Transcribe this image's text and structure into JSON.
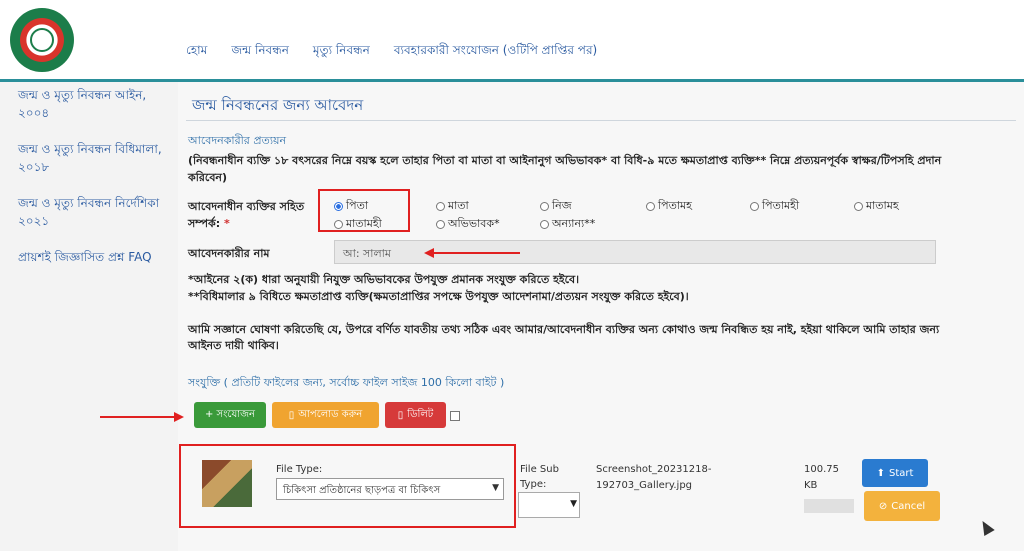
{
  "nav": {
    "items": [
      "হোম",
      "জন্ম নিবন্ধন",
      "মৃত্যু নিবন্ধন",
      "ব্যবহারকারী সংযোজন (ওটিপি প্রাপ্তির পর)"
    ]
  },
  "sidebar": {
    "items": [
      {
        "label": "জন্ম ও মৃত্যু নিবন্ধন আইন, ২০০৪"
      },
      {
        "label": "জন্ম ও মৃত্যু নিবন্ধন বিধিমালা, ২০১৮"
      },
      {
        "label": "জন্ম ও মৃত্যু নিবন্ধন নির্দেশিকা ২০২১"
      },
      {
        "label": "প্রায়শই জিজ্ঞাসিত প্রশ্ন FAQ"
      }
    ]
  },
  "main": {
    "title": "জন্ম নিবন্ধনের জন্য আবেদন",
    "section_heading": "আবেদনকারীর প্রত্যয়ন",
    "instruction": "(নিবন্ধনাধীন ব্যক্তি ১৮ বৎসরের নিম্নে বয়স্ক হলে তাহার পিতা বা মাতা বা আইনানুগ অভিভাবক* বা বিধি-৯ মতে ক্ষমতাপ্রাপ্ত ব্যক্তি** নিম্নে প্রত্যয়নপূর্বক স্বাক্ষর/টিপসহি প্রদান করিবেন)",
    "relation_label": "আবেদনাধীন ব্যক্তির সহিত সম্পর্ক:",
    "relation_required": "*",
    "relations": [
      {
        "label": "পিতা",
        "selected": true
      },
      {
        "label": "মাতা",
        "selected": false
      },
      {
        "label": "নিজ",
        "selected": false
      },
      {
        "label": "পিতামহ",
        "selected": false
      },
      {
        "label": "পিতামহী",
        "selected": false
      },
      {
        "label": "মাতামহ",
        "selected": false
      },
      {
        "label": "মাতামহী",
        "selected": false
      },
      {
        "label": "অভিভাবক*",
        "selected": false
      },
      {
        "label": "অন্যান্য**",
        "selected": false
      }
    ],
    "applicant_name_label": "আবেদনকারীর নাম",
    "applicant_name_value": "আ: সালাম",
    "note1": "*আইনের ২(ক) ধারা অনুযায়ী নিযুক্ত অভিভাবকের উপযুক্ত প্রমানক সংযুক্ত করিতে হইবে।",
    "note2": "**বিধিমালার ৯ বিধিতে ক্ষমতাপ্রাপ্ত ব্যক্তি(ক্ষমতাপ্রাপ্তির সপক্ষে উপযুক্ত আদেশনামা/প্রত্যয়ন সংযুক্ত করিতে হইবে)।",
    "declaration": "আমি সজ্ঞানে ঘোষণা করিতেছি যে, উপরে বর্ণিত যাবতীয় তথ্য সঠিক এবং আমার/আবেদনাধীন ব্যক্তির অন্য কোথাও জন্ম নিবন্ধিত হয় নাই, হইয়া থাকিলে আমি তাহার জন্য আইনত দায়ী থাকিব।",
    "attachment_heading": "সংযুক্তি ( প্রতিটি ফাইলের জন্য, সর্বোচ্চ ফাইল সাইজ 100 কিলো বাইট )"
  },
  "buttons": {
    "add": "+ সংযোজন",
    "upload": "আপলোড করুন",
    "delete": "ডিলিট"
  },
  "file": {
    "type_label": "File Type:",
    "type_value": "চিকিৎসা প্রতিষ্ঠানের ছাড়পত্র বা চিকিৎস",
    "subtype_label": "File Sub Type:",
    "name_line1": "Screenshot_20231218-",
    "name_line2": "192703_Gallery.jpg",
    "size_line1": "100.75",
    "size_line2": "KB",
    "start": "Start",
    "cancel": "Cancel"
  },
  "colors": {
    "accent": "#2a8f9a",
    "link": "#2a5aa0",
    "annotation": "#e02020"
  }
}
